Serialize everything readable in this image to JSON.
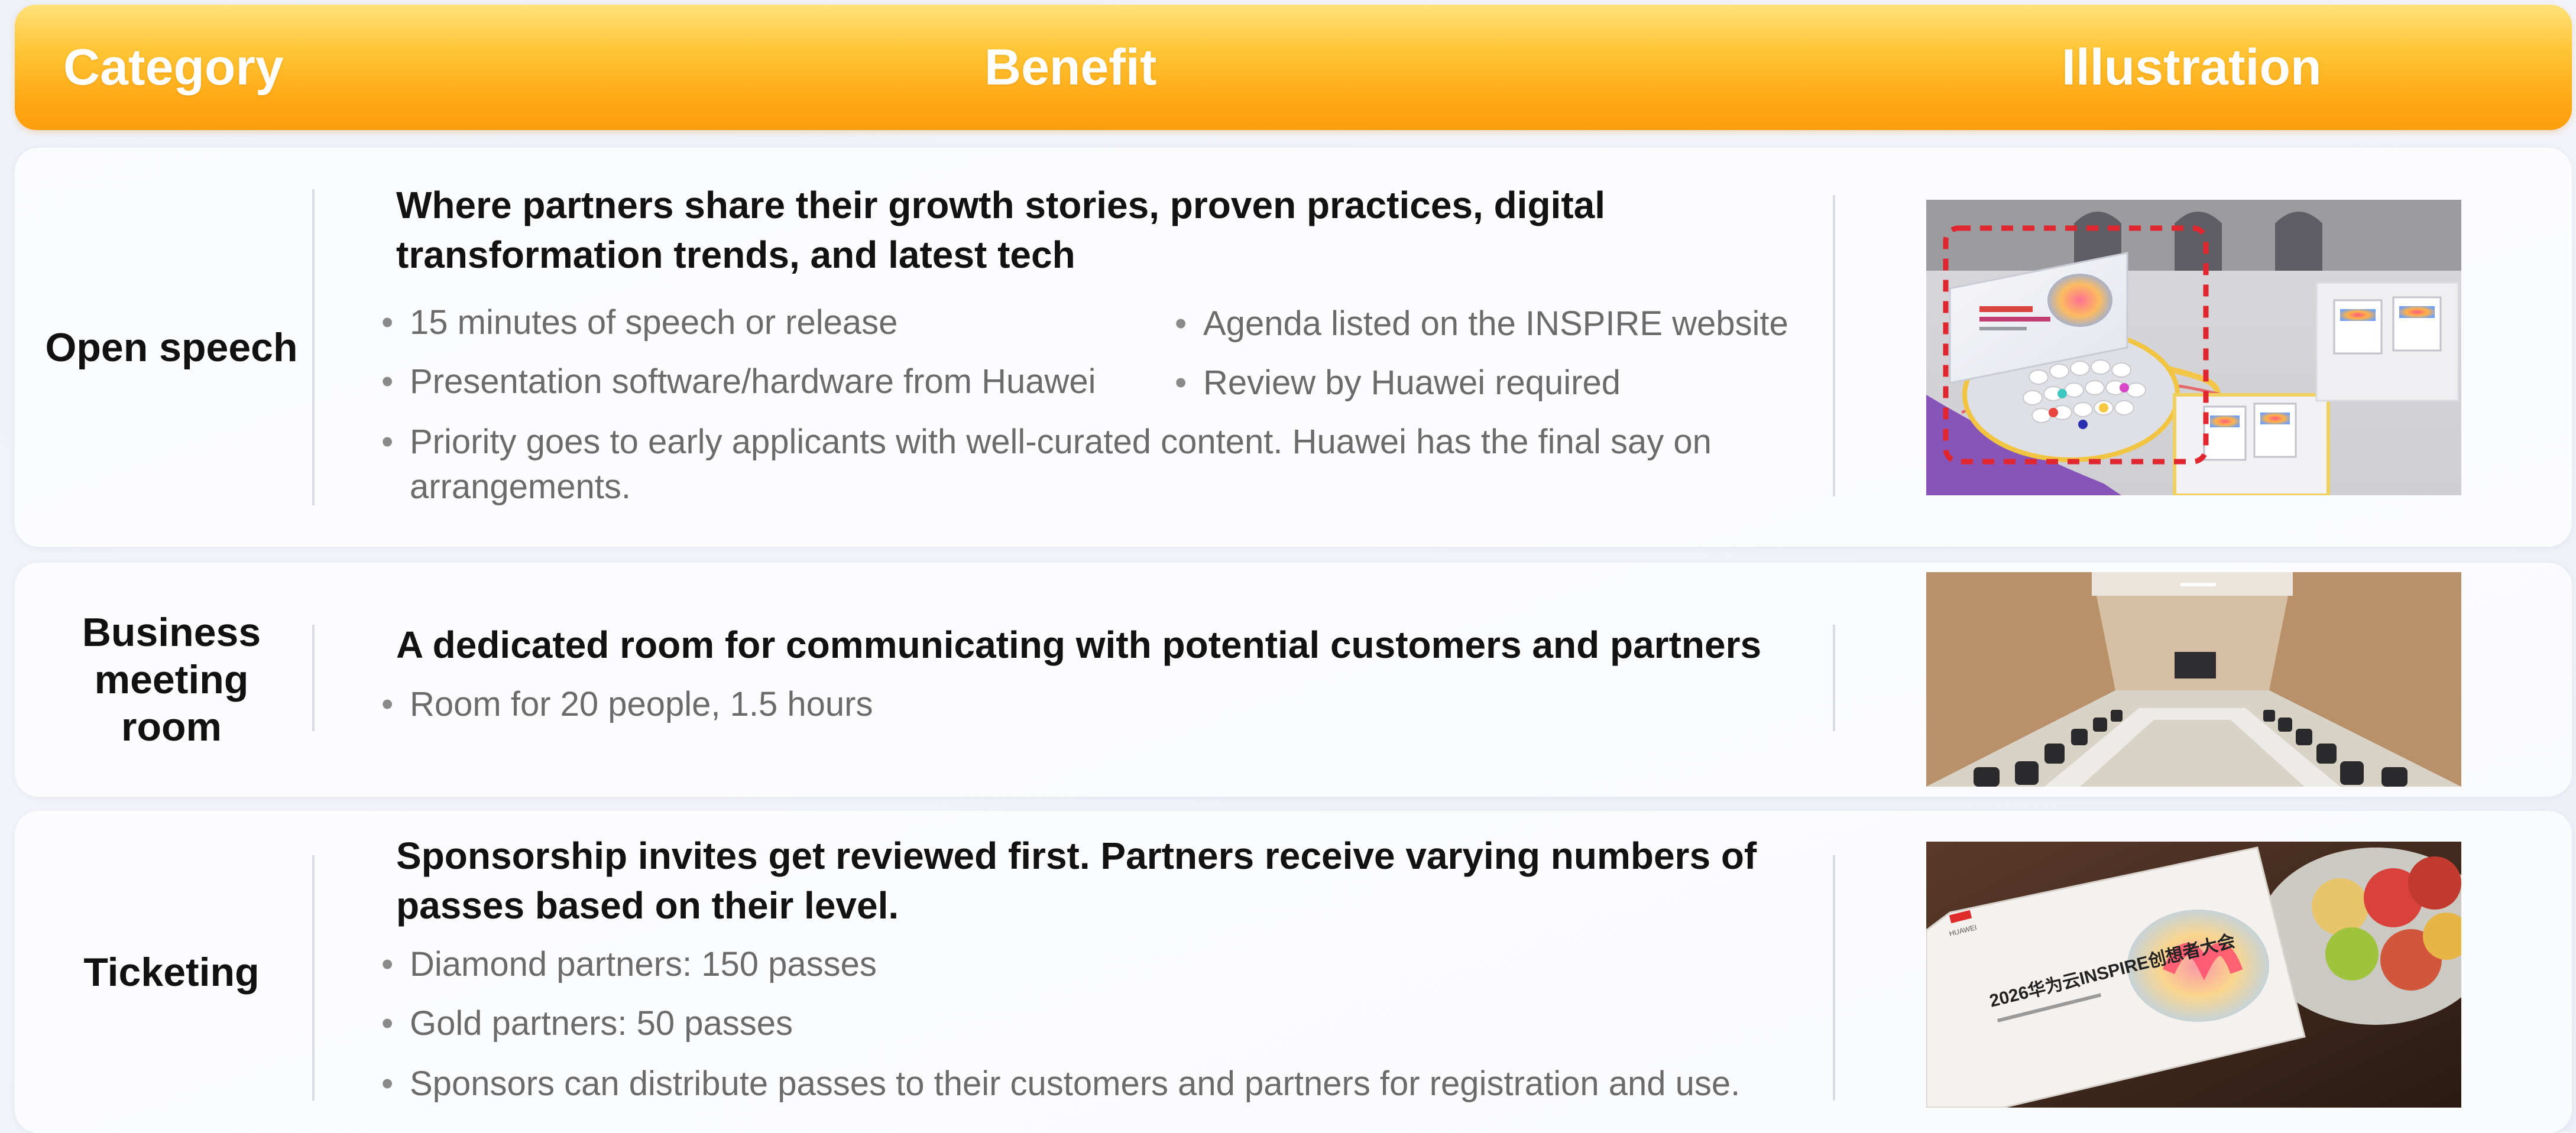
{
  "header": {
    "category": "Category",
    "benefit": "Benefit",
    "illustration": "Illustration"
  },
  "rows": [
    {
      "category": "Open speech",
      "title": "Where partners share their growth stories, proven practices, digital transformation trends, and latest tech",
      "bullets": [
        "15 minutes of speech or release",
        "Agenda listed on the INSPIRE website",
        "Presentation software/hardware from Huawei",
        "Review by Huawei required",
        "Priority goes to early applicants with well-curated content. Huawei has the final say on arrangements."
      ],
      "illustration": "exhibition-booth-render"
    },
    {
      "category": "Business meeting room",
      "title": "A dedicated room for communicating with potential customers and partners",
      "bullets": [
        "Room for 20 people, 1.5 hours"
      ],
      "illustration": "meeting-room-photo"
    },
    {
      "category": "Ticketing",
      "title": "Sponsorship invites get reviewed first. Partners receive varying numbers of passes based on their level.",
      "bullets": [
        "Diamond partners: 150 passes",
        "Gold partners: 50 passes",
        "Sponsors can distribute passes to their customers and partners for registration and use."
      ],
      "illustration": "invitation-card-photo",
      "card_brand": "HUAWEI",
      "card_text": "2026华为云INSPIRE创想者大会"
    }
  ],
  "colors": {
    "header_top": "#ffe27a",
    "header_bottom": "#fd9d0e",
    "title_text": "#121212",
    "bullet_text": "#6b6b6b"
  }
}
